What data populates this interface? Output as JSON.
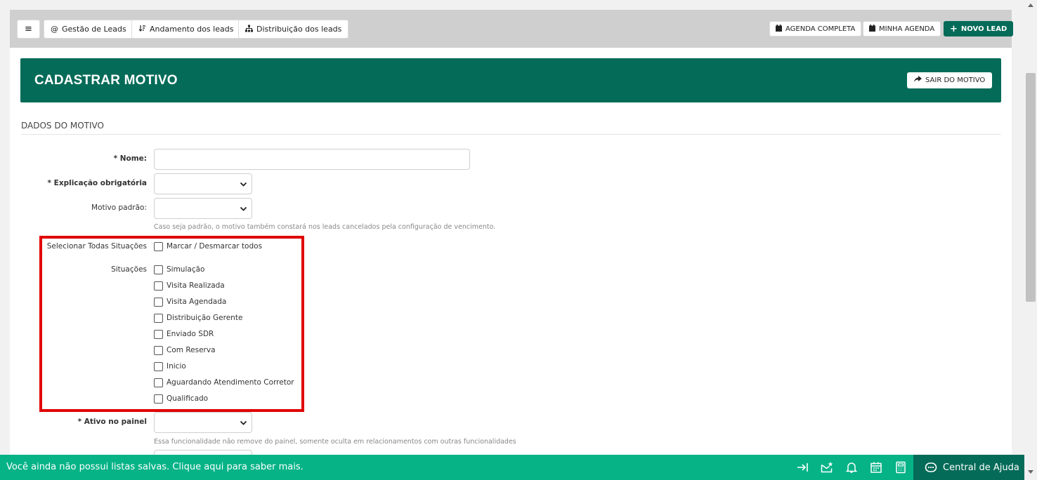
{
  "toolbar": {
    "menu_label": "≡",
    "gestao_label": "Gestão de Leads",
    "andamento_label": "Andamento dos leads",
    "distribuicao_label": "Distribuição dos leads",
    "agenda_completa_label": "AGENDA COMPLETA",
    "minha_agenda_label": "MINHA AGENDA",
    "novo_lead_label": "NOVO LEAD"
  },
  "header": {
    "title": "CADASTRAR MOTIVO",
    "exit_label": "SAIR DO MOTIVO"
  },
  "form": {
    "section_title": "DADOS DO MOTIVO",
    "nome_label": "* Nome:",
    "nome_value": "",
    "explicacao_label": "* Explicação obrigatória",
    "explicacao_value": "",
    "motivo_padrao_label": "Motivo padrão:",
    "motivo_padrao_value": "",
    "motivo_padrao_help": "Caso seja padrão, o motivo também constará nos leads cancelados pela configuração de vencimento.",
    "select_all_label": "Selecionar Todas Situações",
    "select_all_option": "Marcar / Desmarcar todos",
    "situacoes_label": "Situações",
    "situacoes": [
      {
        "label": "Simulação",
        "checked": false
      },
      {
        "label": "Visita Realizada",
        "checked": false
      },
      {
        "label": "Visita Agendada",
        "checked": false
      },
      {
        "label": "Distribuição Gerente",
        "checked": false
      },
      {
        "label": "Enviado SDR",
        "checked": false
      },
      {
        "label": "Com Reserva",
        "checked": false
      },
      {
        "label": "Inicio",
        "checked": false
      },
      {
        "label": "Aguardando Atendimento Corretor",
        "checked": false
      },
      {
        "label": "Qualificado",
        "checked": false
      }
    ],
    "ativo_label": "* Ativo no painel",
    "ativo_value": "",
    "ativo_help": "Essa funcionalidade não remove do painel, somente oculta em relacionamentos com outras funcionalidades"
  },
  "footer": {
    "message": "Você ainda não possui listas salvas. Clique aqui para saber mais.",
    "help_center_label": "Central de Ajuda"
  },
  "colors": {
    "brand_dark_green": "#046b58",
    "footer_green": "#05b387",
    "highlight_red": "#e00000"
  }
}
